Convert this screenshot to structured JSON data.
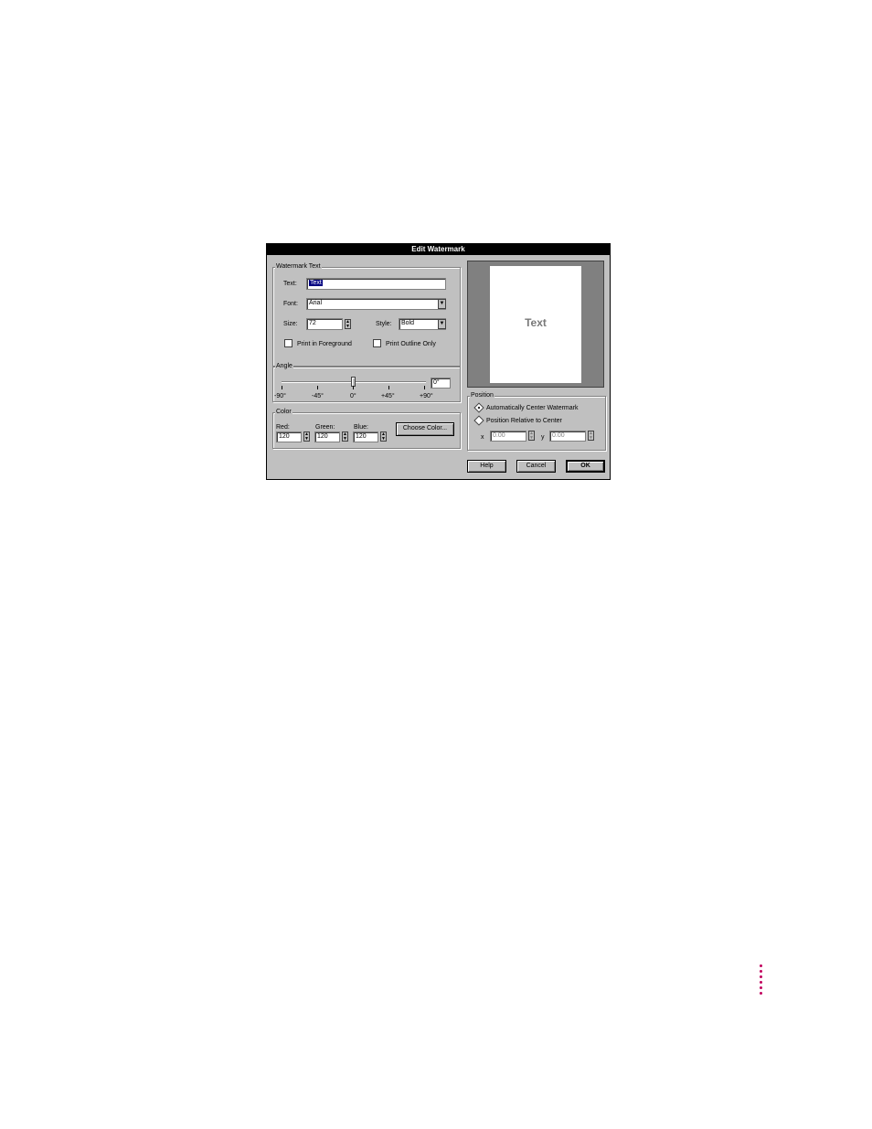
{
  "dialog": {
    "title": "Edit Watermark",
    "watermark_text": {
      "group_label": "Watermark Text",
      "text_label": "Text:",
      "text_value": "Text",
      "font_label": "Font:",
      "font_value": "Arial",
      "size_label": "Size:",
      "size_value": "72",
      "style_label": "Style:",
      "style_value": "Bold",
      "foreground_label": "Print in Foreground",
      "foreground_checked": false,
      "outline_label": "Print Outline Only",
      "outline_checked": false
    },
    "angle": {
      "group_label": "Angle",
      "value": "0°",
      "ticks": [
        "-90°",
        "-45°",
        "0°",
        "+45°",
        "+90°"
      ],
      "slider_value_deg": 0
    },
    "color": {
      "group_label": "Color",
      "red_label": "Red:",
      "red_value": "120",
      "green_label": "Green:",
      "green_value": "120",
      "blue_label": "Blue:",
      "blue_value": "120",
      "choose_label": "Choose Color..."
    },
    "preview": {
      "text": "Text",
      "text_color": "#787878"
    },
    "position": {
      "group_label": "Position",
      "auto_label": "Automatically Center Watermark",
      "auto_selected": true,
      "relative_label": "Position Relative to Center",
      "relative_selected": false,
      "x_label": "x",
      "x_value": "0.00",
      "y_label": "y",
      "y_value": "0.00"
    },
    "buttons": {
      "help": "Help",
      "cancel": "Cancel",
      "ok": "OK"
    }
  },
  "accent_color": "#c2005e"
}
